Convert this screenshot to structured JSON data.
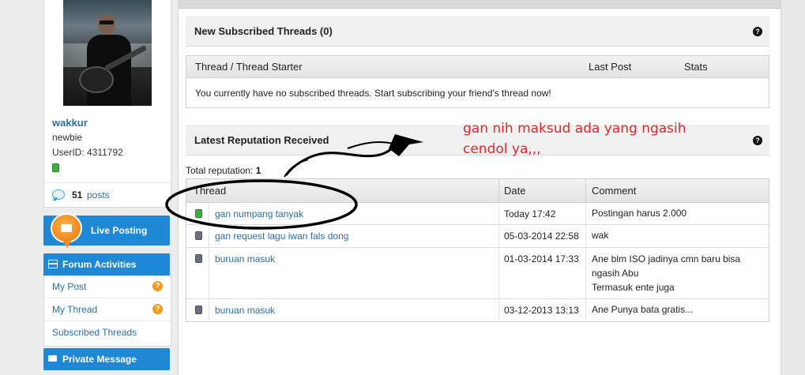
{
  "sidebar": {
    "username": "wakkur",
    "rank": "newbie",
    "userid": "UserID: 4311792",
    "post_count": "51",
    "posts_label": "posts",
    "live_posting": "Live Posting",
    "forum_activities": {
      "title": "Forum Activities",
      "items": [
        {
          "label": "My Post",
          "badge": "?"
        },
        {
          "label": "My Thread",
          "badge": "?"
        },
        {
          "label": "Subscribed Threads",
          "badge": ""
        }
      ]
    },
    "private_message": "Private Message"
  },
  "subscribed": {
    "title": "New Subscribed Threads (0)",
    "col_thread": "Thread / Thread Starter",
    "col_last_post": "Last Post",
    "col_stats": "Stats",
    "empty_message": "You currently have no subscribed threads. Start subscribing your friend's thread now!"
  },
  "reputation": {
    "title": "Latest Reputation Received",
    "total_label": "Total reputation:",
    "total_value": "1",
    "col_thread": "Thread",
    "col_date": "Date",
    "col_comment": "Comment",
    "rows": [
      {
        "status": "green",
        "thread": "gan numpang tanyak",
        "date": "Today 17:42",
        "comment": "Postingan harus 2.000"
      },
      {
        "status": "grey",
        "thread": "gan request lagu iwan fals dong",
        "date": "05-03-2014 22:58",
        "comment": "wak"
      },
      {
        "status": "grey",
        "thread": "buruan masuk",
        "date": "01-03-2014 17:33",
        "comment": "Ane blm ISO jadinya cmn baru bisa ngasih Abu\nTermasuk ente juga"
      },
      {
        "status": "grey",
        "thread": "buruan masuk",
        "date": "03-12-2013 13:13",
        "comment": "Ane Punya bata gratis..."
      }
    ]
  },
  "annotation": {
    "text": "gan nih maksud ada yang ngasih cendol ya,,,",
    "color": "#e4262a"
  },
  "icons": {
    "help": "help-icon",
    "chat": "chat-icon",
    "live": "live-posting-icon",
    "forum": "forum-icon",
    "mail": "mail-icon"
  },
  "colors": {
    "accent": "#1f88d6",
    "link": "#2a6fa8",
    "online": "#3fae3f",
    "offline": "#6b7080",
    "badge": "#f59b1b"
  }
}
